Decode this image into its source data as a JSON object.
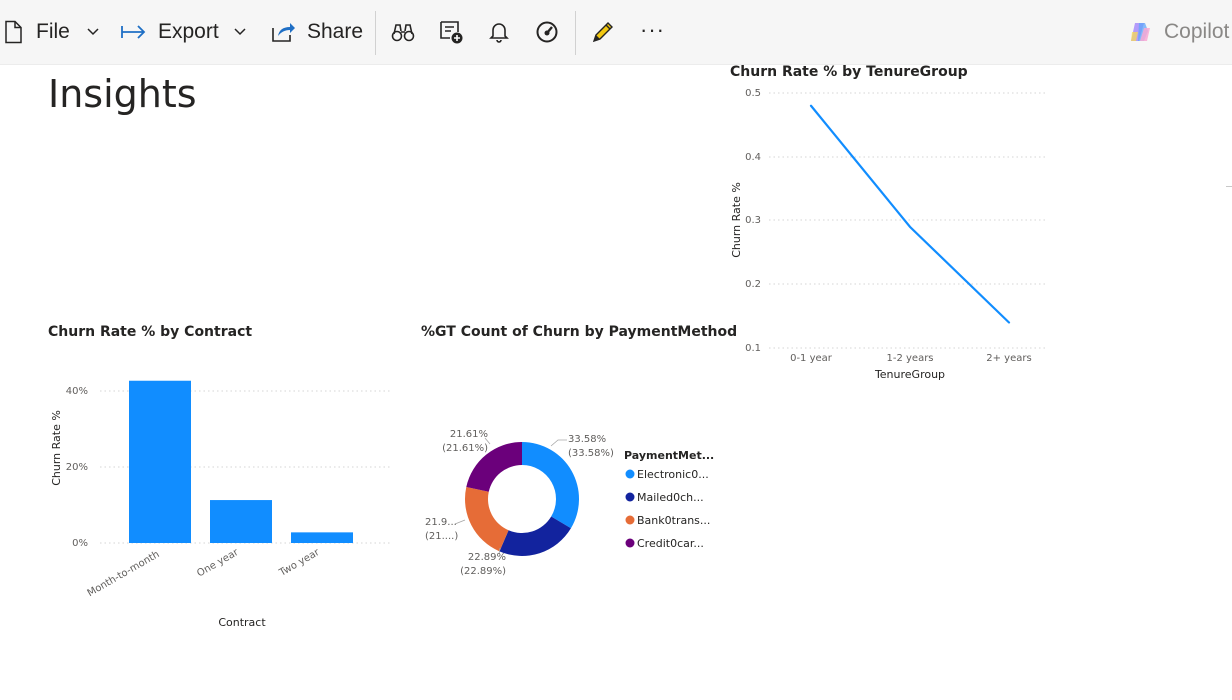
{
  "toolbar": {
    "file_label": "File",
    "export_label": "Export",
    "share_label": "Share",
    "copilot_label": "Copilot",
    "more_label": "···"
  },
  "page": {
    "title": "Insights"
  },
  "colors": {
    "accent_blue": "#118DFF",
    "navy": "#12239E",
    "orange": "#E66C37",
    "purple": "#6B007B",
    "copilot_gradient": [
      "#f9a8d4",
      "#a78bfa",
      "#60a5fa",
      "#fde047"
    ]
  },
  "chart_data": [
    {
      "type": "line",
      "title": "Churn Rate % by TenureGroup",
      "xlabel": "TenureGroup",
      "ylabel": "Churn Rate %",
      "categories": [
        "0-1 year",
        "1-2 years",
        "2+ years"
      ],
      "values": [
        0.48,
        0.29,
        0.14
      ],
      "ylim": [
        0.1,
        0.5
      ],
      "yticks": [
        "0.5",
        "0.4",
        "0.3",
        "0.2",
        "0.1"
      ],
      "grid": true
    },
    {
      "type": "bar",
      "title": "Churn Rate % by Contract",
      "xlabel": "Contract",
      "ylabel": "Churn Rate %",
      "categories": [
        "Month-to-month",
        "One year",
        "Two year"
      ],
      "values": [
        42.7,
        11.3,
        2.8
      ],
      "ylim": [
        0,
        45
      ],
      "yticks": [
        "40%",
        "20%",
        "0%"
      ],
      "grid": true
    },
    {
      "type": "pie",
      "title": "%GT Count of Churn by PaymentMethod",
      "legend_title": "PaymentMet...",
      "legend_position": "right",
      "slices": [
        {
          "label": "Electronic0...",
          "value": 33.58,
          "text": "33.58%",
          "subtext": "(33.58%)"
        },
        {
          "label": "Mailed0ch...",
          "value": 22.89,
          "text": "22.89%",
          "subtext": "(22.89%)"
        },
        {
          "label": "Bank0trans...",
          "value": 21.92,
          "text": "21.9...",
          "subtext": "(21....)"
        },
        {
          "label": "Credit0car...",
          "value": 21.61,
          "text": "21.61%",
          "subtext": "(21.61%)"
        }
      ]
    }
  ]
}
